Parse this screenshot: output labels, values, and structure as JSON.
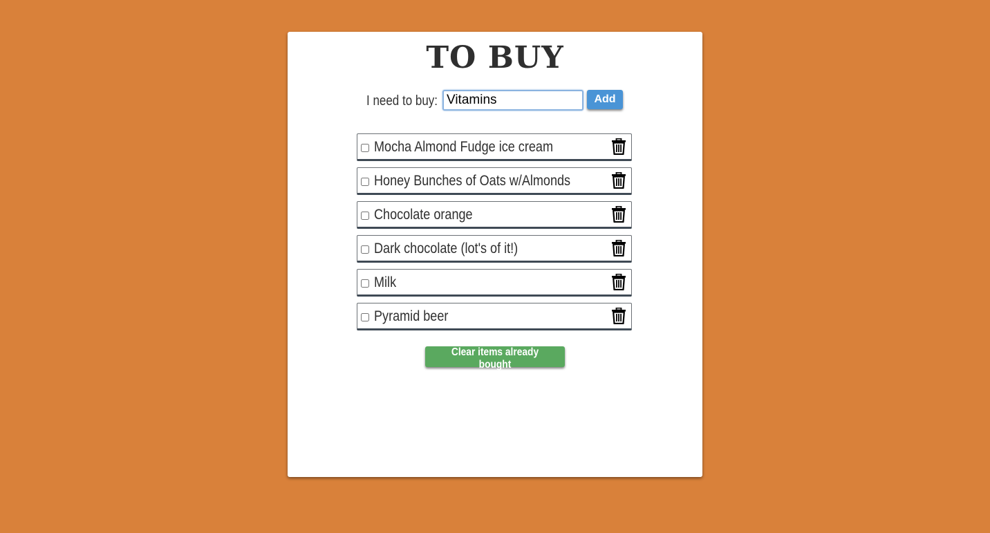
{
  "colors": {
    "background": "#d9813a",
    "card": "#ffffff",
    "add_button": "#4a94d6",
    "clear_button": "#5aa95f",
    "text": "#2f2f2f"
  },
  "header": {
    "title": "TO BUY"
  },
  "add_form": {
    "label": "I need to buy:",
    "input_value": "Vitamins",
    "add_label": "Add"
  },
  "items": [
    {
      "label": "Mocha Almond Fudge ice cream",
      "checked": false,
      "icon": "trash-icon"
    },
    {
      "label": "Honey Bunches of Oats w/Almonds",
      "checked": false,
      "icon": "trash-icon"
    },
    {
      "label": "Chocolate orange",
      "checked": false,
      "icon": "trash-icon"
    },
    {
      "label": "Dark chocolate (lot's of it!)",
      "checked": false,
      "icon": "trash-icon"
    },
    {
      "label": "Milk",
      "checked": false,
      "icon": "trash-icon"
    },
    {
      "label": "Pyramid beer",
      "checked": false,
      "icon": "trash-icon"
    }
  ],
  "footer": {
    "clear_label": "Clear items already bought"
  }
}
